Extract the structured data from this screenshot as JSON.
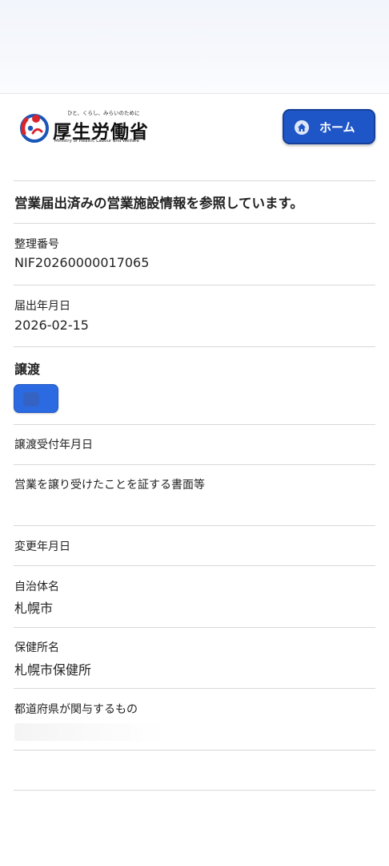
{
  "header": {
    "logo": {
      "tagline": "ひと、くらし、みらいのために",
      "name": "厚生労働省",
      "english": "Ministry of Health, Labour and Welfare"
    },
    "home_button": {
      "label": "ホーム",
      "icon": "home-icon"
    }
  },
  "notice": "営業届出済みの営業施設情報を参照しています。",
  "fields": {
    "reference_number": {
      "label": "整理番号",
      "value": "NIF20260000017065"
    },
    "notification_date": {
      "label": "届出年月日",
      "value": "2026-02-15"
    },
    "transfer": {
      "title": "譲渡"
    },
    "transfer_date": {
      "label": "譲渡受付年月日",
      "value": ""
    },
    "transfer_document": {
      "label": "営業を譲り受けたことを証する書面等",
      "value": ""
    },
    "change_date": {
      "label": "変更年月日",
      "value": ""
    },
    "municipality": {
      "label": "自治体名",
      "value": "札幌市"
    },
    "health_center": {
      "label": "保健所名",
      "value": "札幌市保健所"
    },
    "prefecture_related": {
      "label": "都道府県が関与するもの",
      "value": ""
    }
  },
  "colors": {
    "primary_button": "#1f56c7",
    "toggle": "#2b6ae0",
    "logo_red": "#d9262b",
    "logo_blue": "#1a55b8"
  }
}
